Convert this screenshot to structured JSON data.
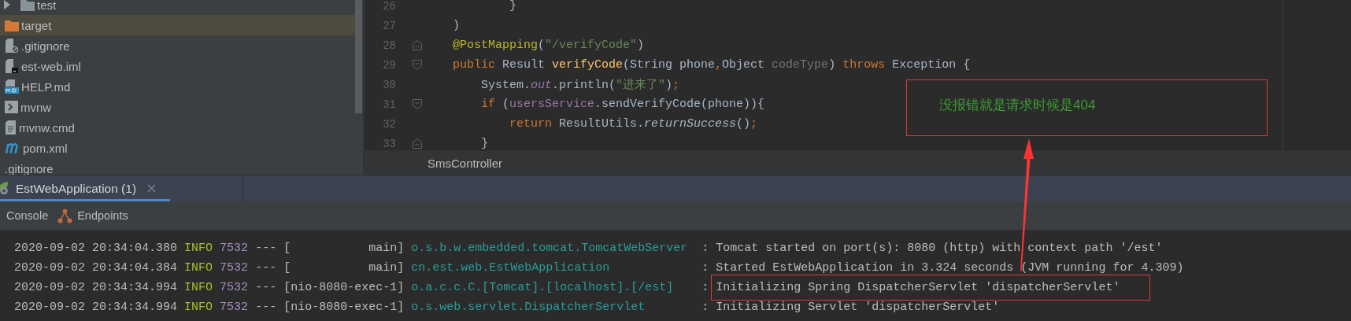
{
  "project_tree": [
    {
      "children": [
        {
          "label": "test",
          "kind": "folder",
          "expanded": false,
          "selected": false
        }
      ]
    },
    {
      "label": "target",
      "kind": "excluded_folder",
      "selected": true
    },
    {
      "label": ".gitignore",
      "kind": "ignore_file",
      "selected": false
    },
    {
      "label": "est-web.iml",
      "kind": "module_file",
      "selected": false
    },
    {
      "label": "HELP.md",
      "kind": "markdown",
      "selected": false
    },
    {
      "label": "mvnw",
      "kind": "script",
      "selected": false
    },
    {
      "label": "mvnw.cmd",
      "kind": "text_file",
      "selected": false
    },
    {
      "label": "pom.xml",
      "kind": "build_file",
      "selected": false
    },
    {
      "label": ".gitignore",
      "kind": "plain",
      "selected": false
    }
  ],
  "editor": {
    "lines": [
      {
        "number": "26",
        "kind": "plain",
        "tokens": [
          {
            "t": "            }",
            "kind": "plain"
          }
        ]
      },
      {
        "number": "27",
        "kind": "plain",
        "tokens": [
          {
            "t": "    )",
            "kind": "plain"
          }
        ]
      },
      {
        "number": "28",
        "kind": "fold_end",
        "tokens": [
          {
            "t": "    @PostMapping",
            "kind": "annotation"
          },
          {
            "t": "(",
            "kind": "plain"
          },
          {
            "t": "\"/verifyCode\"",
            "kind": "string"
          },
          {
            "t": ")",
            "kind": "plain"
          }
        ]
      },
      {
        "number": "29",
        "kind": "fold_start",
        "tokens": [
          {
            "t": "    public",
            "kind": "keyword"
          },
          {
            "t": " Result ",
            "kind": "plain"
          },
          {
            "t": "verifyCode",
            "kind": "method"
          },
          {
            "t": "(String phone",
            "kind": "plain"
          },
          {
            "t": ",",
            "kind": "keyword"
          },
          {
            "t": "Object ",
            "kind": "plain"
          },
          {
            "t": "codeType",
            "kind": "unused"
          },
          {
            "t": ") ",
            "kind": "plain"
          },
          {
            "t": "throws",
            "kind": "keyword"
          },
          {
            "t": " Exception {",
            "kind": "plain"
          }
        ]
      },
      {
        "number": "30",
        "kind": "plain",
        "tokens": [
          {
            "t": "        System.",
            "kind": "plain"
          },
          {
            "t": "out",
            "kind": "static_field"
          },
          {
            "t": ".println(",
            "kind": "plain"
          },
          {
            "t": "\"进来了\"",
            "kind": "string"
          },
          {
            "t": ")",
            "kind": "plain"
          },
          {
            "t": ";",
            "kind": "keyword"
          }
        ]
      },
      {
        "number": "31",
        "kind": "fold_start",
        "tokens": [
          {
            "t": "        if",
            "kind": "keyword"
          },
          {
            "t": " (",
            "kind": "plain"
          },
          {
            "t": "usersService",
            "kind": "field"
          },
          {
            "t": ".sendVerifyCode(phone)){",
            "kind": "plain"
          }
        ]
      },
      {
        "number": "32",
        "kind": "plain",
        "tokens": [
          {
            "t": "            return",
            "kind": "keyword"
          },
          {
            "t": " ResultUtils.",
            "kind": "plain"
          },
          {
            "t": "returnSuccess",
            "kind": "static_method"
          },
          {
            "t": "()",
            "kind": "plain"
          },
          {
            "t": ";",
            "kind": "keyword"
          }
        ]
      },
      {
        "number": "33",
        "kind": "fold_end",
        "tokens": [
          {
            "t": "        }",
            "kind": "plain"
          }
        ]
      }
    ],
    "breadcrumb": "SmsController"
  },
  "run_tabs": [
    {
      "label": "EstWebApplication (1)",
      "selected": true
    }
  ],
  "console_tabs": [
    {
      "label": "Console",
      "kind": "plain"
    },
    {
      "label": "Endpoints",
      "kind": "endpoints"
    }
  ],
  "console": {
    "rows": [
      {
        "timestamp": "2020-09-02 20:34:04.380",
        "level": "INFO",
        "pid": "7532",
        "separator": "---",
        "thread": "[           main]",
        "logger": "o.s.b.w.embedded.tomcat.TomcatWebServer",
        "colon": ":",
        "message": "Tomcat started on port(s): 8080 (http) with context path '/est'",
        "highlighted": false
      },
      {
        "timestamp": "2020-09-02 20:34:04.384",
        "level": "INFO",
        "pid": "7532",
        "separator": "---",
        "thread": "[           main]",
        "logger": "cn.est.web.EstWebApplication",
        "colon": ":",
        "message": "Started EstWebApplication in 3.324 seconds (JVM running for 4.309)",
        "highlighted": false
      },
      {
        "timestamp": "2020-09-02 20:34:34.994",
        "level": "INFO",
        "pid": "7532",
        "separator": "---",
        "thread": "[nio-8080-exec-1]",
        "logger": "o.a.c.c.C.[Tomcat].[localhost].[/est]",
        "colon": ":",
        "message": "Initializing Spring DispatcherServlet 'dispatcherServlet'",
        "highlighted": true
      },
      {
        "timestamp": "2020-09-02 20:34:34.994",
        "level": "INFO",
        "pid": "7532",
        "separator": "---",
        "thread": "[nio-8080-exec-1]",
        "logger": "o.s.web.servlet.DispatcherServlet",
        "colon": ":",
        "message": "Initializing Servlet 'dispatcherServlet'",
        "highlighted": false
      }
    ]
  },
  "annotation": {
    "text": "没报错就是请求时候是404"
  }
}
